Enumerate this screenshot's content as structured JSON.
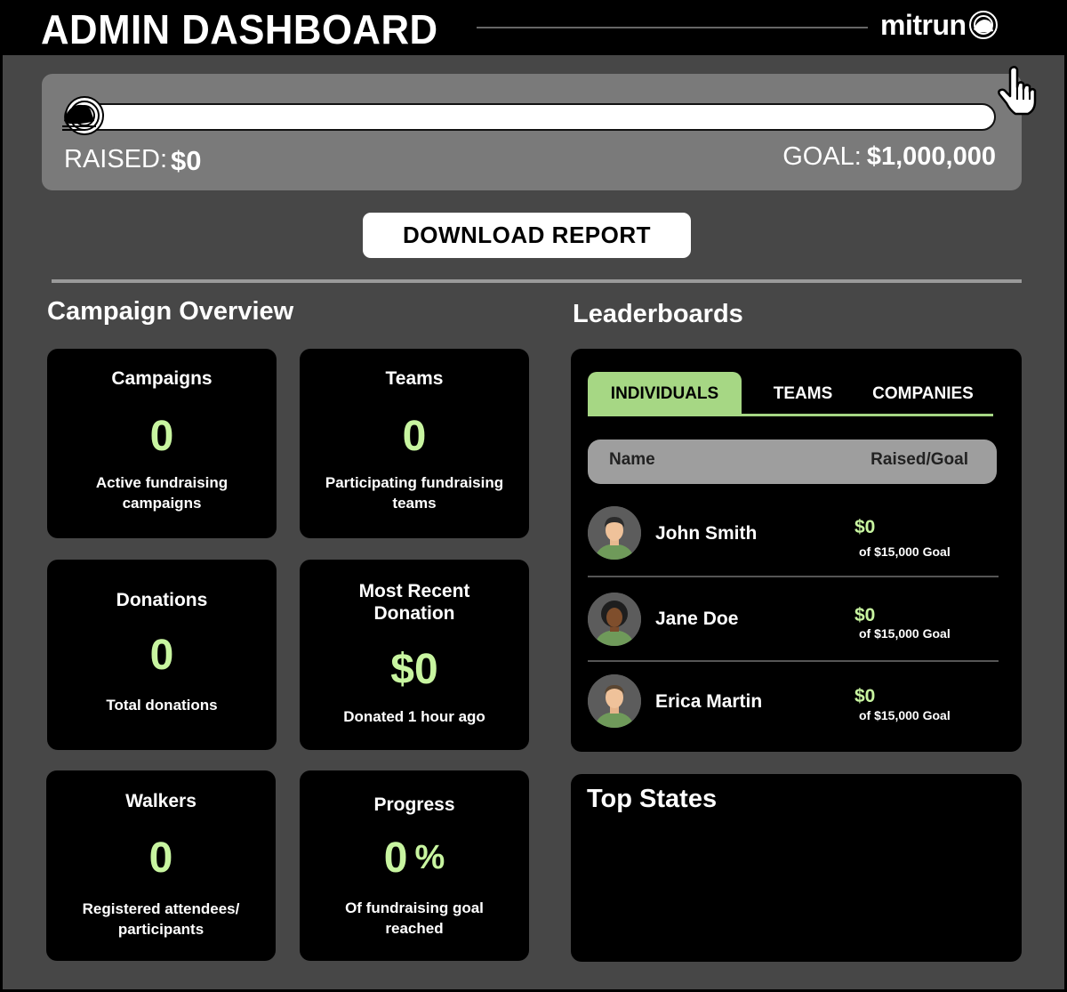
{
  "header": {
    "title": "ADMIN DASHBOARD",
    "logo_text": "mitrun"
  },
  "progress": {
    "raised_label": "RAISED:",
    "raised_value": "$0",
    "goal_label": "GOAL:",
    "goal_value": "$1,000,000",
    "fill_fraction": 0
  },
  "actions": {
    "download_label": "DOWNLOAD REPORT"
  },
  "overview": {
    "title": "Campaign Overview",
    "cards": [
      {
        "title": "Campaigns",
        "value": "0",
        "desc": "Active fundraising campaigns"
      },
      {
        "title": "Teams",
        "value": "0",
        "desc": "Participating fundraising teams"
      },
      {
        "title": "Donations",
        "value": "0",
        "desc": "Total donations"
      },
      {
        "title": "Most Recent Donation",
        "value": "$0",
        "desc": "Donated 1 hour ago"
      },
      {
        "title": "Walkers",
        "value": "0",
        "desc": "Registered attendees/ participants"
      },
      {
        "title": "Progress",
        "value": "0",
        "unit": "%",
        "desc": "Of fundraising goal reached"
      }
    ]
  },
  "leaderboards": {
    "title": "Leaderboards",
    "tabs": [
      "INDIVIDUALS",
      "TEAMS",
      "COMPANIES"
    ],
    "active_tab": "INDIVIDUALS",
    "columns": [
      "Name",
      "Raised/Goal"
    ],
    "rows": [
      {
        "name": "John Smith",
        "raised": "$0",
        "goal": "of $15,000 Goal"
      },
      {
        "name": "Jane Doe",
        "raised": "$0",
        "goal": "of $15,000 Goal"
      },
      {
        "name": "Erica Martin",
        "raised": "$0",
        "goal": "of $15,000 Goal"
      }
    ]
  },
  "top_states": {
    "title": "Top States"
  },
  "colors": {
    "accent_green": "#a6d784",
    "value_green": "#c8f5a0",
    "panel_bg": "#474747",
    "card_bg": "#000000"
  },
  "icons": [
    "mitrun-logo-icon",
    "runner-shoe-icon",
    "pointer-cursor-icon",
    "avatar-icon"
  ]
}
